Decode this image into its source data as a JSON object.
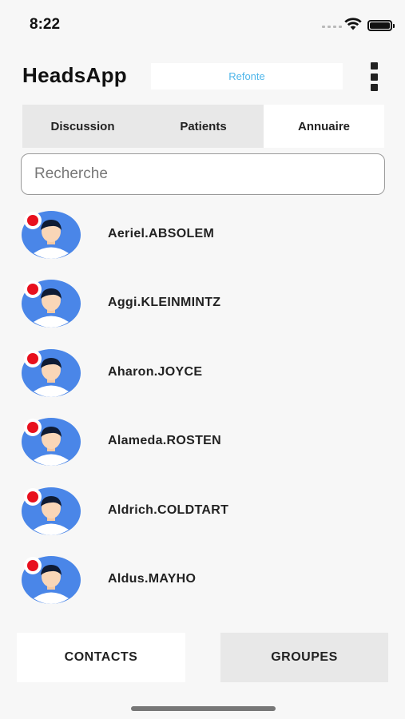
{
  "status_bar": {
    "time": "8:22"
  },
  "header": {
    "title": "HeadsApp",
    "refonte_label": "Refonte",
    "more_icon": "vertical-dots-icon"
  },
  "tabs": [
    {
      "label": "Discussion",
      "active": false
    },
    {
      "label": "Patients",
      "active": false
    },
    {
      "label": "Annuaire",
      "active": true
    }
  ],
  "search": {
    "placeholder": "Recherche",
    "value": ""
  },
  "contacts": [
    {
      "name": "Aeriel.ABSOLEM",
      "status": "offline"
    },
    {
      "name": "Aggi.KLEINMINTZ",
      "status": "offline"
    },
    {
      "name": "Aharon.JOYCE",
      "status": "offline"
    },
    {
      "name": "Alameda.ROSTEN",
      "status": "offline"
    },
    {
      "name": "Aldrich.COLDTART",
      "status": "offline"
    },
    {
      "name": "Aldus.MAYHO",
      "status": "offline"
    }
  ],
  "bottom": {
    "contacts_label": "CONTACTS",
    "groupes_label": "GROUPES"
  },
  "colors": {
    "accent": "#4fb6ea",
    "avatar_bg": "#4a86e8",
    "status_offline": "#e8101e"
  }
}
